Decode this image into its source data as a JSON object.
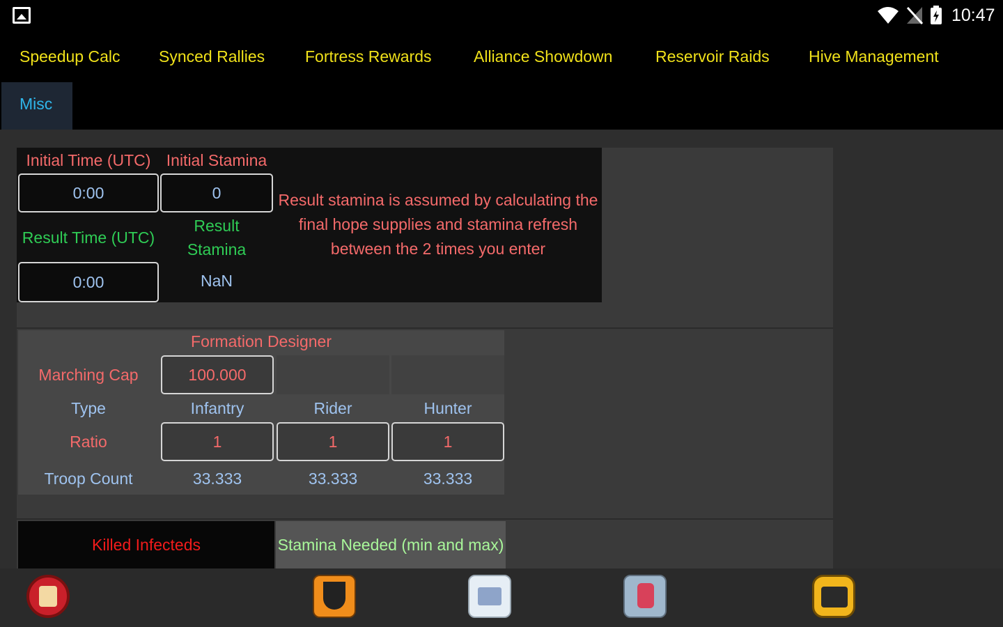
{
  "status_bar": {
    "time": "10:47",
    "icons": [
      "image-icon",
      "wifi-icon",
      "signal-off-icon",
      "battery-charging-icon"
    ]
  },
  "nav": {
    "tabs": [
      {
        "label": "Speedup Calc"
      },
      {
        "label": "Synced Rallies"
      },
      {
        "label": "Fortress Rewards"
      },
      {
        "label": "Alliance Showdown"
      },
      {
        "label": "Reservoir Raids"
      },
      {
        "label": "Hive Management"
      },
      {
        "label": "Misc"
      }
    ],
    "active_tab": "Misc"
  },
  "stamina": {
    "initial_time_label": "Initial Time (UTC)",
    "initial_stamina_label": "Initial Stamina",
    "initial_time_value": "0:00",
    "initial_stamina_value": "0",
    "result_time_label": "Result Time (UTC)",
    "result_stamina_label": "Result\nStamina",
    "result_time_value": "0:00",
    "result_stamina_value": "NaN",
    "note": "Result stamina is assumed by calculating the final hope supplies and stamina refresh between the 2 times you enter"
  },
  "formation": {
    "title": "Formation Designer",
    "marching_cap_label": "Marching Cap",
    "marching_cap_value": "100.000",
    "type_label": "Type",
    "ratio_label": "Ratio",
    "troop_count_label": "Troop Count",
    "types": [
      "Infantry",
      "Rider",
      "Hunter"
    ],
    "ratios": [
      "1",
      "1",
      "1"
    ],
    "troop_counts": [
      "33.333",
      "33.333",
      "33.333"
    ]
  },
  "killed": {
    "label": "Killed Infecteds",
    "stamina_needed_label": "Stamina Needed (min and max)"
  },
  "bottom_apps": [
    "app-icon-1",
    "app-icon-2",
    "app-icon-3",
    "app-icon-4",
    "app-icon-5"
  ],
  "colors": {
    "nav_yellow": "#f0e11a",
    "active_blue": "#2fb6ea",
    "label_red": "#f46a6a",
    "label_green": "#2fcc55"
  }
}
